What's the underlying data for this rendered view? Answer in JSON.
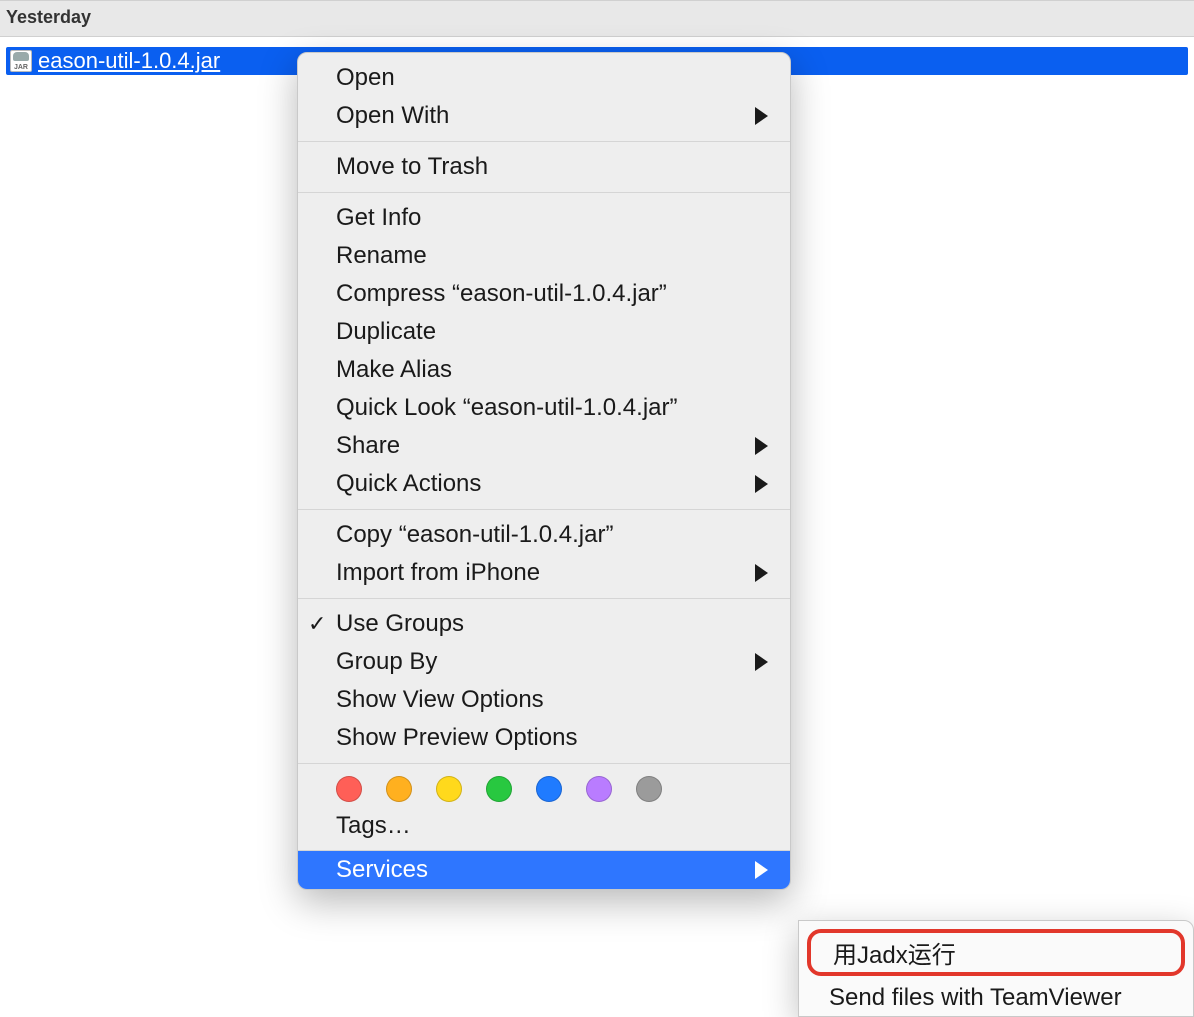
{
  "section_header": "Yesterday",
  "file": {
    "name": "eason-util-1.0.4.jar",
    "icon_label": "JAR"
  },
  "context_menu": {
    "groups": [
      {
        "items": [
          {
            "label": "Open",
            "arrow": false
          },
          {
            "label": "Open With",
            "arrow": true
          }
        ]
      },
      {
        "items": [
          {
            "label": "Move to Trash",
            "arrow": false
          }
        ]
      },
      {
        "items": [
          {
            "label": "Get Info",
            "arrow": false
          },
          {
            "label": "Rename",
            "arrow": false
          },
          {
            "label": "Compress “eason-util-1.0.4.jar”",
            "arrow": false
          },
          {
            "label": "Duplicate",
            "arrow": false
          },
          {
            "label": "Make Alias",
            "arrow": false
          },
          {
            "label": "Quick Look “eason-util-1.0.4.jar”",
            "arrow": false
          },
          {
            "label": "Share",
            "arrow": true
          },
          {
            "label": "Quick Actions",
            "arrow": true
          }
        ]
      },
      {
        "items": [
          {
            "label": "Copy “eason-util-1.0.4.jar”",
            "arrow": false
          },
          {
            "label": "Import from iPhone",
            "arrow": true
          }
        ]
      },
      {
        "items": [
          {
            "label": "Use Groups",
            "arrow": false,
            "checked": true
          },
          {
            "label": "Group By",
            "arrow": true
          },
          {
            "label": "Show View Options",
            "arrow": false
          },
          {
            "label": "Show Preview Options",
            "arrow": false
          }
        ]
      }
    ],
    "tag_colors": [
      "#ff5f57",
      "#ffb01f",
      "#ffd91c",
      "#28c840",
      "#1f7bff",
      "#b97cff",
      "#9b9b9b"
    ],
    "tags_label": "Tags…",
    "services": {
      "label": "Services",
      "arrow": true,
      "highlighted": true
    }
  },
  "submenu": {
    "items": [
      {
        "label": "用Jadx运行",
        "boxed": true
      },
      {
        "label": "Send files with TeamViewer",
        "boxed": false
      }
    ]
  }
}
